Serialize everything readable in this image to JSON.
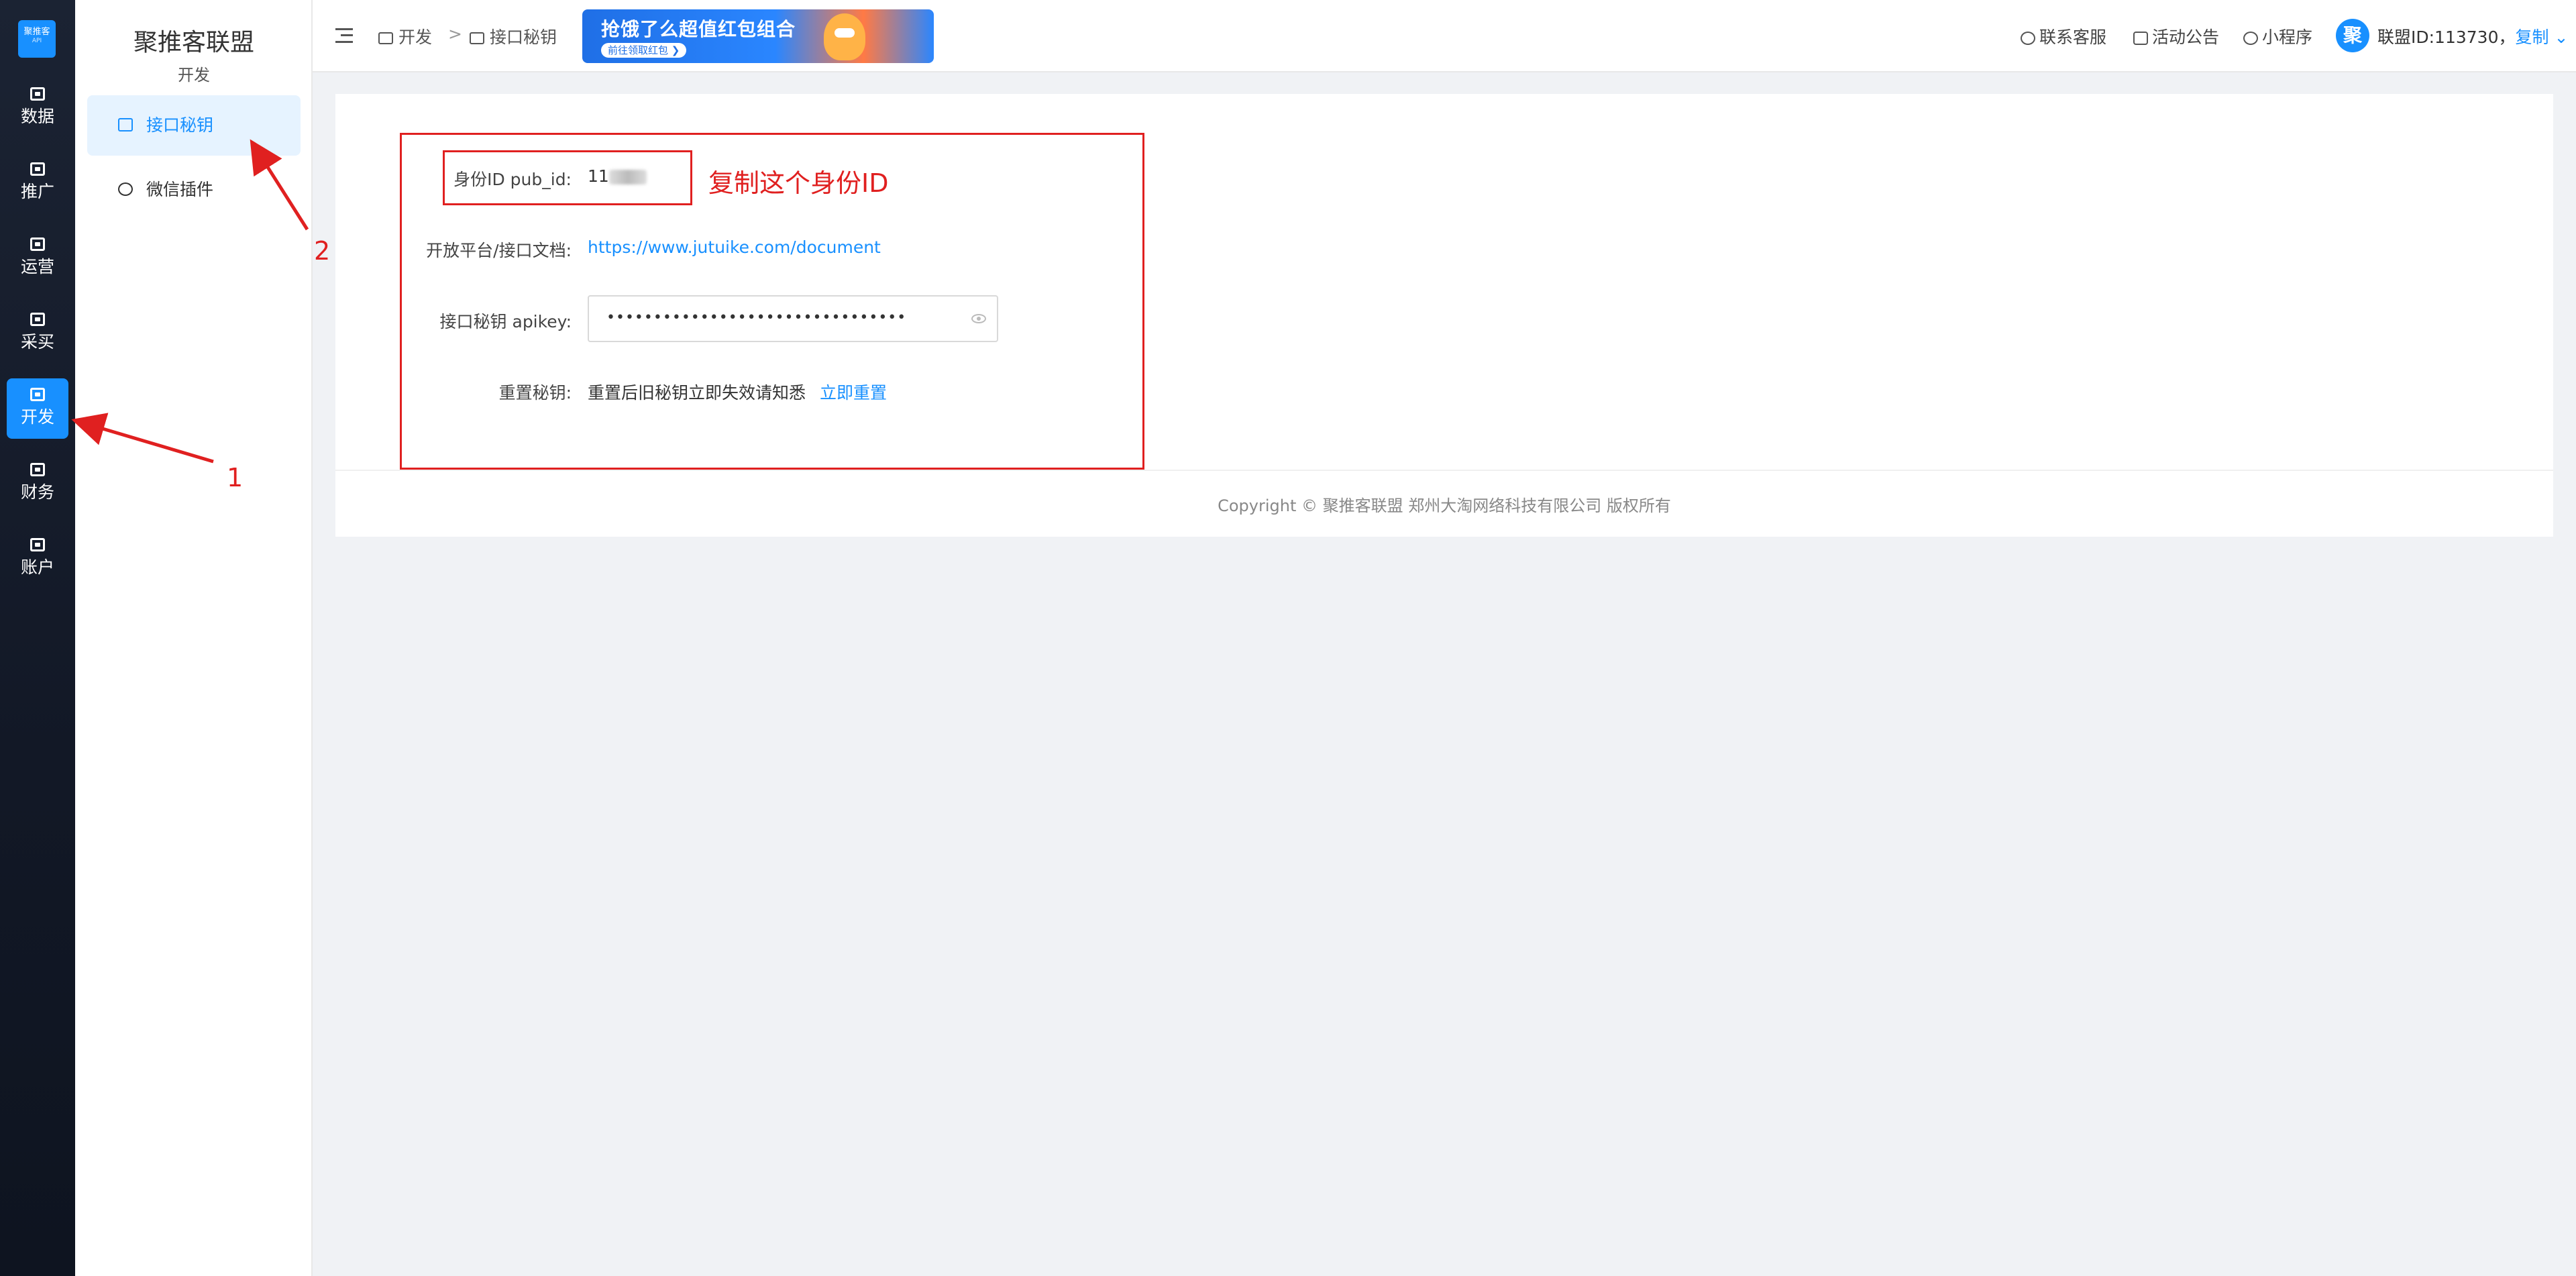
{
  "rail": {
    "logo": "聚推客",
    "logo_sub": "API",
    "items": [
      {
        "label": "数据",
        "icon": "chart-icon"
      },
      {
        "label": "推广",
        "icon": "briefcase-icon"
      },
      {
        "label": "运营",
        "icon": "bag-icon"
      },
      {
        "label": "采买",
        "icon": "cart-icon"
      },
      {
        "label": "开发",
        "icon": "code-icon",
        "active": true
      },
      {
        "label": "财务",
        "icon": "wallet-icon"
      },
      {
        "label": "账户",
        "icon": "user-card-icon"
      }
    ]
  },
  "sidebar": {
    "title": "聚推客联盟",
    "subtitle": "开发",
    "items": [
      {
        "label": "接口秘钥",
        "active": true
      },
      {
        "label": "微信插件"
      }
    ]
  },
  "header": {
    "breadcrumb": [
      "开发",
      "接口秘钥"
    ],
    "separator": ">",
    "banner_main": "抢饿了么超值红包组合",
    "banner_pill": "前往领取红包 ❯",
    "links": [
      "联系客服",
      "活动公告",
      "小程序"
    ],
    "avatar_char": "聚",
    "union_id": "联盟ID:113730，",
    "copy": "复制"
  },
  "main": {
    "pub_id_label": "身份ID pub_id:",
    "pub_id_value": "11",
    "doc_label": "开放平台/接口文档:",
    "doc_link": "https://www.jutuike.com/document",
    "apikey_label": "接口秘钥 apikey:",
    "apikey_masked": "••••••••••••••••••••••••••••••••",
    "reset_label": "重置秘钥:",
    "reset_text": "重置后旧秘钥立即失效请知悉",
    "reset_link": "立即重置"
  },
  "footer": {
    "text": "Copyright ©  聚推客联盟 郑州大淘网络科技有限公司 版权所有"
  },
  "annotations": {
    "copy_hint": "复制这个身份ID",
    "marker_1": "1",
    "marker_2": "2",
    "color": "#e02020"
  }
}
